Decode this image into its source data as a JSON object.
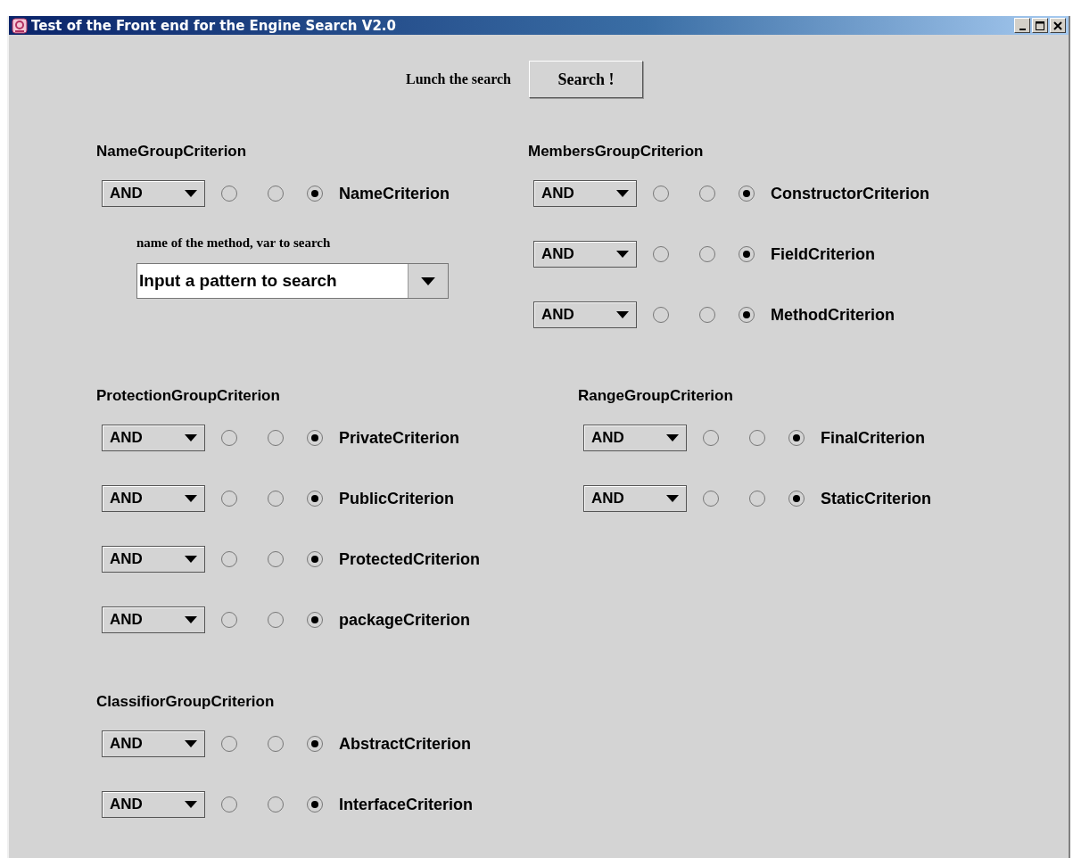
{
  "window": {
    "title": "Test of the Front end for the Engine Search V2.0"
  },
  "search_bar": {
    "label": "Lunch the search",
    "button": "Search !"
  },
  "sections": [
    [
      {
        "title": "NameGroupCriterion",
        "criteria": [
          {
            "operator": "AND",
            "radios": [
              {
                "selected": false
              },
              {
                "selected": false
              },
              {
                "selected": true
              }
            ],
            "label": "NameCriterion"
          }
        ],
        "pattern": {
          "label": "name of the method, var to search",
          "value": "Input a pattern to search"
        }
      },
      {
        "title": "MembersGroupCriterion",
        "criteria": [
          {
            "operator": "AND",
            "radios": [
              {
                "selected": false
              },
              {
                "selected": false
              },
              {
                "selected": true
              }
            ],
            "label": "ConstructorCriterion"
          },
          {
            "operator": "AND",
            "radios": [
              {
                "selected": false
              },
              {
                "selected": false
              },
              {
                "selected": true
              }
            ],
            "label": "FieldCriterion"
          },
          {
            "operator": "AND",
            "radios": [
              {
                "selected": false
              },
              {
                "selected": false
              },
              {
                "selected": true
              }
            ],
            "label": "MethodCriterion"
          }
        ]
      }
    ],
    [
      {
        "title": "ProtectionGroupCriterion",
        "criteria": [
          {
            "operator": "AND",
            "radios": [
              {
                "selected": false
              },
              {
                "selected": false
              },
              {
                "selected": true
              }
            ],
            "label": "PrivateCriterion"
          },
          {
            "operator": "AND",
            "radios": [
              {
                "selected": false
              },
              {
                "selected": false
              },
              {
                "selected": true
              }
            ],
            "label": "PublicCriterion"
          },
          {
            "operator": "AND",
            "radios": [
              {
                "selected": false
              },
              {
                "selected": false
              },
              {
                "selected": true
              }
            ],
            "label": "ProtectedCriterion"
          },
          {
            "operator": "AND",
            "radios": [
              {
                "selected": false
              },
              {
                "selected": false
              },
              {
                "selected": true
              }
            ],
            "label": "packageCriterion"
          }
        ]
      },
      {
        "title": "RangeGroupCriterion",
        "criteria": [
          {
            "operator": "AND",
            "radios": [
              {
                "selected": false
              },
              {
                "selected": false
              },
              {
                "selected": true
              }
            ],
            "label": "FinalCriterion"
          },
          {
            "operator": "AND",
            "radios": [
              {
                "selected": false
              },
              {
                "selected": false
              },
              {
                "selected": true
              }
            ],
            "label": "StaticCriterion"
          }
        ]
      }
    ],
    [
      {
        "title": "ClassifiorGroupCriterion",
        "criteria": [
          {
            "operator": "AND",
            "radios": [
              {
                "selected": false
              },
              {
                "selected": false
              },
              {
                "selected": true
              }
            ],
            "label": "AbstractCriterion"
          },
          {
            "operator": "AND",
            "radios": [
              {
                "selected": false
              },
              {
                "selected": false
              },
              {
                "selected": true
              }
            ],
            "label": "InterfaceCriterion"
          }
        ]
      }
    ]
  ]
}
